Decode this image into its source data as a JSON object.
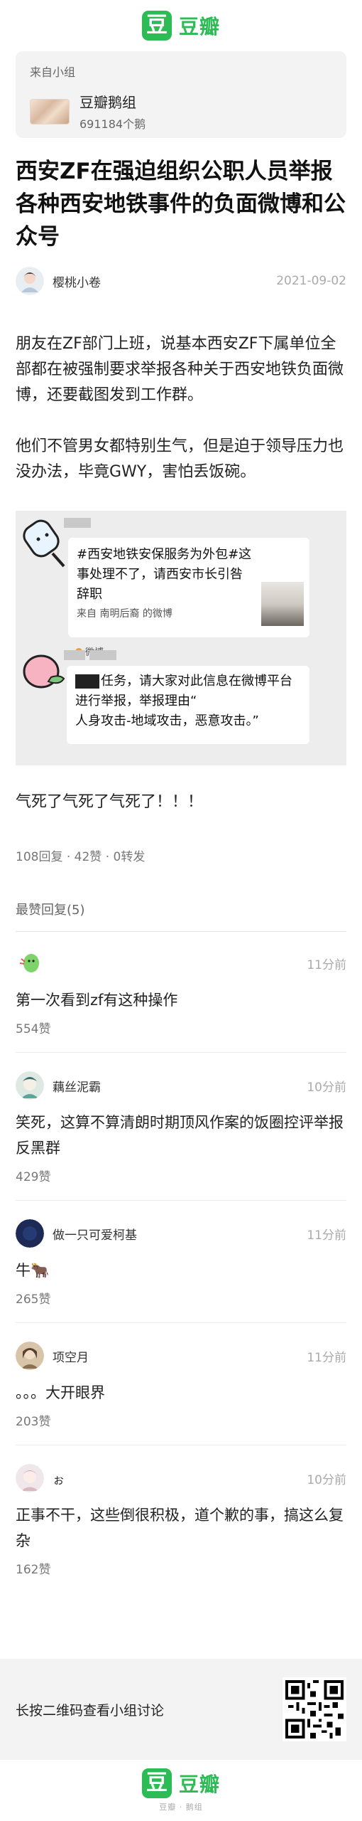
{
  "app": {
    "logo_char": "豆",
    "logo_text": "豆瓣"
  },
  "group": {
    "from_label": "来自小组",
    "name": "豆瓣鹅组",
    "members": "691184个鹅"
  },
  "post": {
    "title": "西安ZF在强迫组织公职人员举报各种西安地铁事件的负面微博和公众号",
    "author": "樱桃小卷",
    "date": "2021-09-02",
    "paragraphs": [
      "朋友在ZF部门上班，说基本西安ZF下属单位全部都在被强制要求举报各种关于西安地铁负面微博，还要截图发到工作群。",
      "他们不管男女都特别生气，但是迫于领导压力也没办法，毕竟GWY，害怕丢饭碗。"
    ],
    "image": {
      "weibo_text": "#西安地铁安保服务为外包#这事处理不了，请西安市长引咎辞职",
      "weibo_source": "来自 南明后裔 的微博",
      "weibo_footer": "微博",
      "chat_text_1": "任务，请大家对此信息在微博平台进行举报，举报理由“",
      "chat_text_2": "人身攻击-地域攻击，恶意攻击。”"
    },
    "closing": "气死了气死了气死了！！！",
    "stats": "108回复 · 42赞 · 0转发"
  },
  "comments_section": {
    "title": "最赞回复(5)",
    "comments": [
      {
        "name": "",
        "time": "11分前",
        "text": "第一次看到zf有这种操作",
        "likes": "554赞"
      },
      {
        "name": "藕丝泥霸",
        "time": "10分前",
        "text": "笑死，这算不算清朗时期顶风作案的饭圈控评举报反黑群",
        "likes": "429赞"
      },
      {
        "name": "做一只可爱柯基",
        "time": "11分前",
        "text": "牛🐂",
        "likes": "265赞"
      },
      {
        "name": "项空月",
        "time": "11分前",
        "text": "。。。大开眼界",
        "likes": "203赞"
      },
      {
        "name": "ぉ",
        "time": "10分前",
        "text": "正事不干，这些倒很积极，道个歉的事，搞这么复杂",
        "likes": "162赞"
      }
    ]
  },
  "footer": {
    "qr_hint": "长按二维码查看小组讨论",
    "bottom_sub": "豆瓣 · 鹅组"
  },
  "colors": {
    "brand": "#2dbb55",
    "panel": "#f3f3f3"
  }
}
